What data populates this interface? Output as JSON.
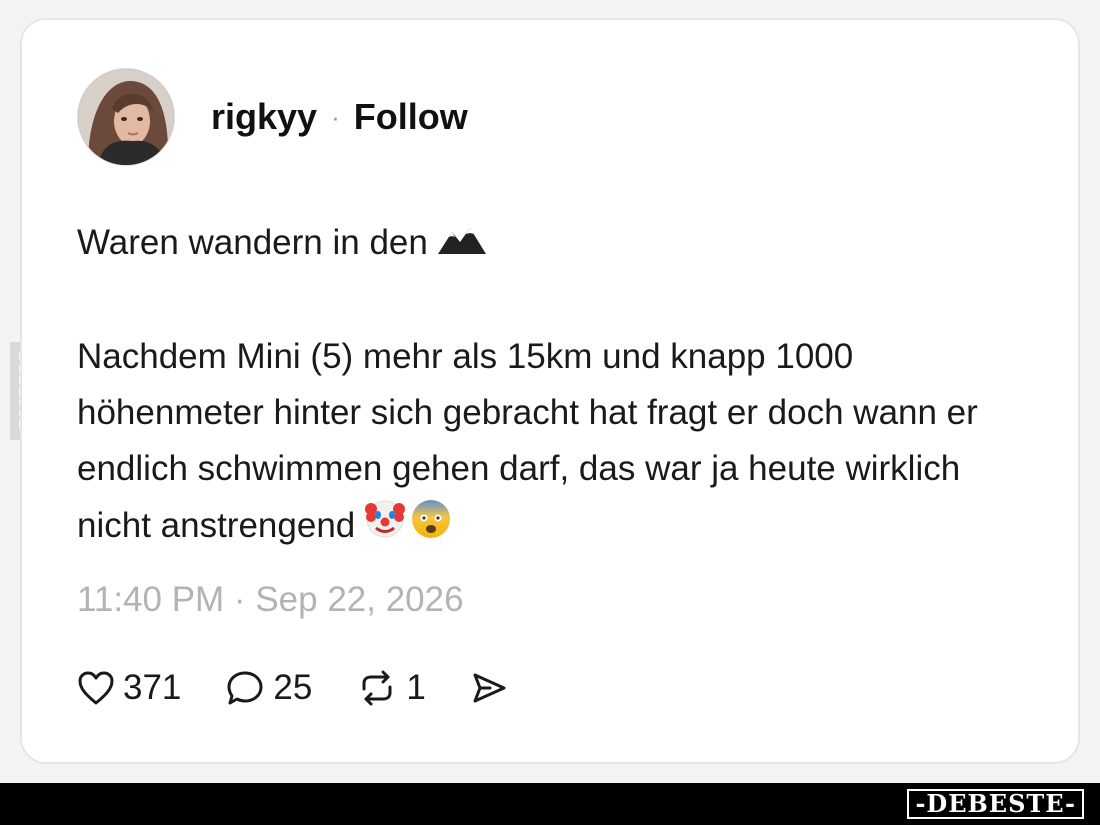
{
  "post": {
    "username": "rigkyy",
    "separator": "·",
    "follow_label": "Follow",
    "line1": "Waren wandern in den",
    "line1_emoji": "mountain-emoji",
    "para2": "Nachdem  Mini (5) mehr als 15km und knapp 1000 höhenmeter hinter sich gebracht hat fragt er doch wann er endlich schwimmen gehen darf, das war ja heute wirklich nicht anstrengend",
    "para2_emojis": [
      "clown-face-emoji",
      "fearful-face-emoji"
    ],
    "timestamp": "11:40 PM · Sep 22, 2026"
  },
  "actions": {
    "likes": "371",
    "replies": "25",
    "reposts": "1",
    "icons": [
      "heart-icon",
      "reply-bubble-icon",
      "repost-icon",
      "share-icon"
    ]
  },
  "watermark": {
    "brand": "-DEBESTE-",
    "side": "DEBESTE"
  },
  "colors": {
    "text": "#1a1a1a",
    "muted": "#b3b3b3",
    "card_border": "#e6e6e6",
    "footer": "#000000"
  }
}
